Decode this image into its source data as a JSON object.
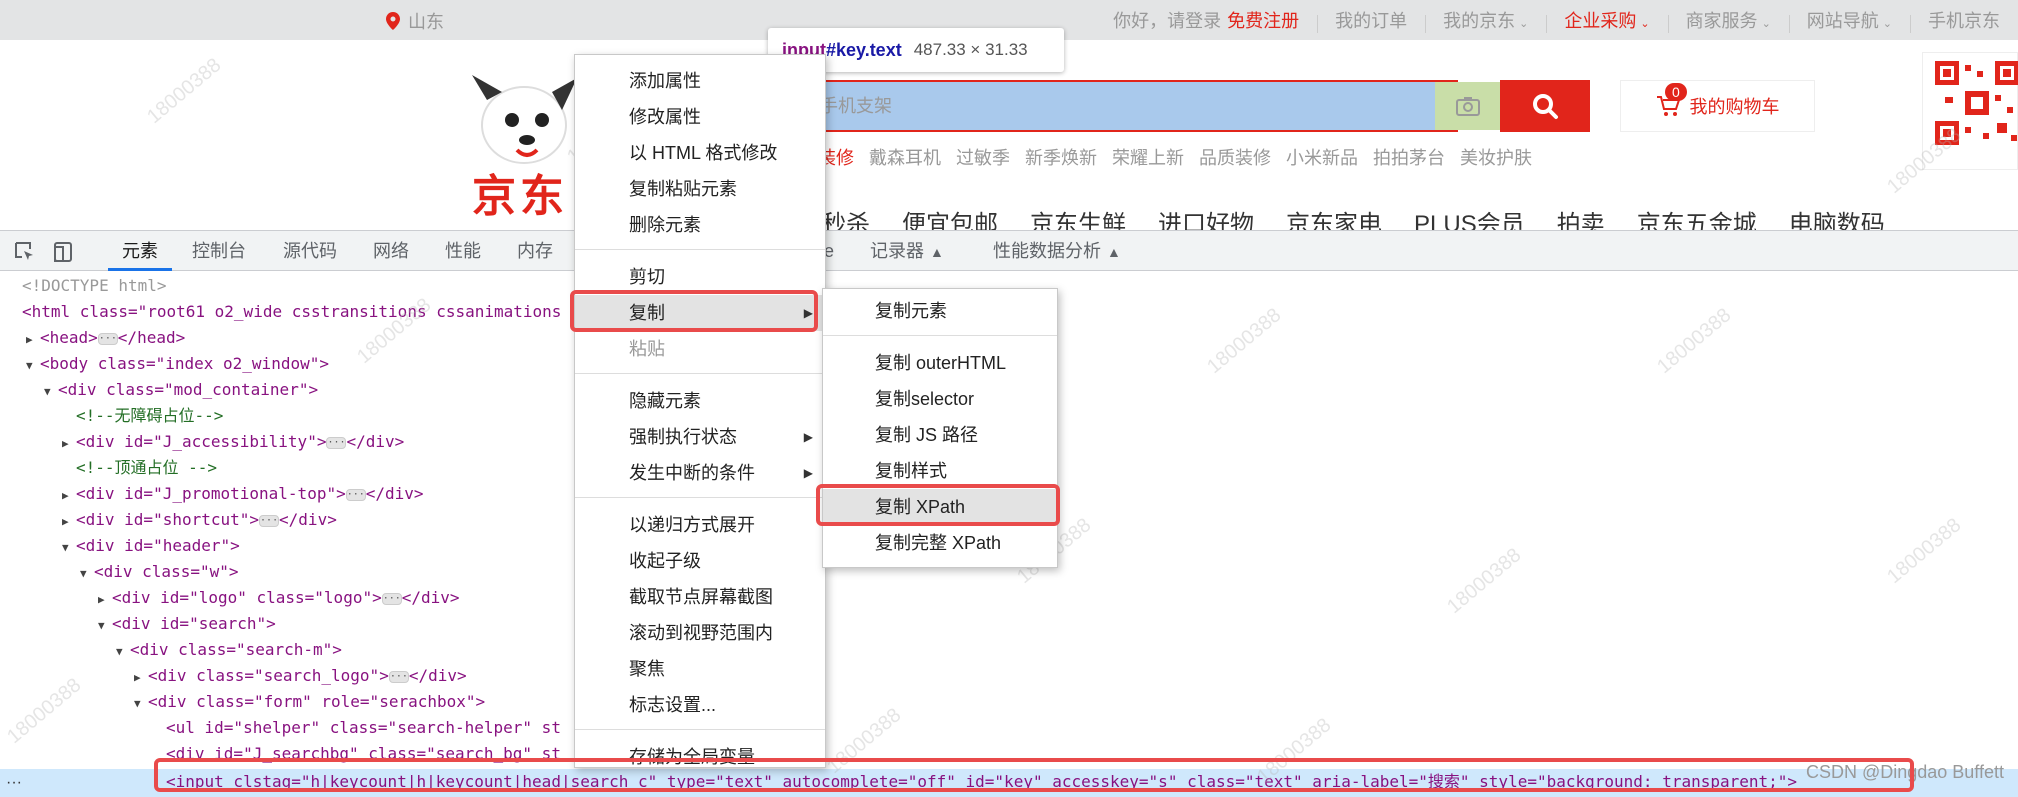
{
  "jd": {
    "location": "山东",
    "greeting": "你好，请登录",
    "register": "免费注册",
    "top_links": [
      "我的订单",
      "我的京东",
      "企业采购",
      "商家服务",
      "网站导航",
      "手机京东"
    ],
    "logo_text": "京东",
    "search_placeholder": "手机支架",
    "cart_label": "我的购物车",
    "cart_count": "0",
    "hotwords": [
      "装修",
      "戴森耳机",
      "过敏季",
      "新季焕新",
      "荣耀上新",
      "品质装修",
      "小米新品",
      "拍拍茅台",
      "美妆护肤"
    ],
    "nav": [
      "秒杀",
      "便宜包邮",
      "京东生鲜",
      "进口好物",
      "京东家电",
      "PLUS会员",
      "拍卖",
      "京东五金城",
      "电脑数码"
    ],
    "brand_color": "#e1251b"
  },
  "tooltip": {
    "selector_tag": "input",
    "selector_rest": "#key.text",
    "size": "487.33 × 31.33"
  },
  "devtools": {
    "tabs": [
      "元素",
      "控制台",
      "源代码",
      "网络",
      "性能",
      "内存"
    ],
    "tab_partial": "e",
    "tabs_right": [
      "记录器",
      "性能数据分析"
    ],
    "dom_lines": {
      "doctype": "<!DOCTYPE html>",
      "html_open": "<html class=\"root61 o2_wide csstransitions cssanimations",
      "head": "<head>",
      "head_close": "</head>",
      "body_open": "<body class=\"index o2_window\">",
      "mod_container": "<div class=\"mod_container\">",
      "comment1": "<!--无障碍占位-->",
      "accessibility": "<div id=\"J_accessibility\">",
      "comment2": "<!--顶通占位 -->",
      "promotional": "<div id=\"J_promotional-top\">",
      "shortcut": "<div id=\"shortcut\">",
      "header": "<div id=\"header\">",
      "w": "<div class=\"w\">",
      "logo": "<div id=\"logo\" class=\"logo\">",
      "search": "<div id=\"search\">",
      "search_m": "<div class=\"search-m\">",
      "search_logo": "<div class=\"search_logo\">",
      "form": "<div class=\"form\" role=\"serachbox\">",
      "shelper": "<ul id=\"shelper\" class=\"search-helper\" st",
      "searchbg": "<div id=\"J_searchbg\" class=\"search_bg\" st",
      "div_close": "</div>",
      "selected": "<input clstag=\"h|keycount|h|keycount|head|search_c\" type=\"text\" autocomplete=\"off\" id=\"key\" accesskey=\"s\" class=\"text\" aria-label=\"搜索\" style=\"background: transparent;\">"
    }
  },
  "context_menu": {
    "items": [
      "添加属性",
      "修改属性",
      "以 HTML 格式修改",
      "复制粘贴元素",
      "删除元素",
      "剪切",
      "复制",
      "粘贴",
      "隐藏元素",
      "强制执行状态",
      "发生中断的条件",
      "以递归方式展开",
      "收起子级",
      "截取节点屏幕截图",
      "滚动到视野范围内",
      "聚焦",
      "标志设置...",
      "存储为全局变量"
    ]
  },
  "copy_submenu": {
    "items": [
      "复制元素",
      "复制 outerHTML",
      "复制selector",
      "复制 JS 路径",
      "复制样式",
      "复制 XPath",
      "复制完整 XPath"
    ]
  },
  "watermark": "18000388",
  "credit": "CSDN @Dingdao Buffett",
  "highlight_color": "#e94b4b"
}
